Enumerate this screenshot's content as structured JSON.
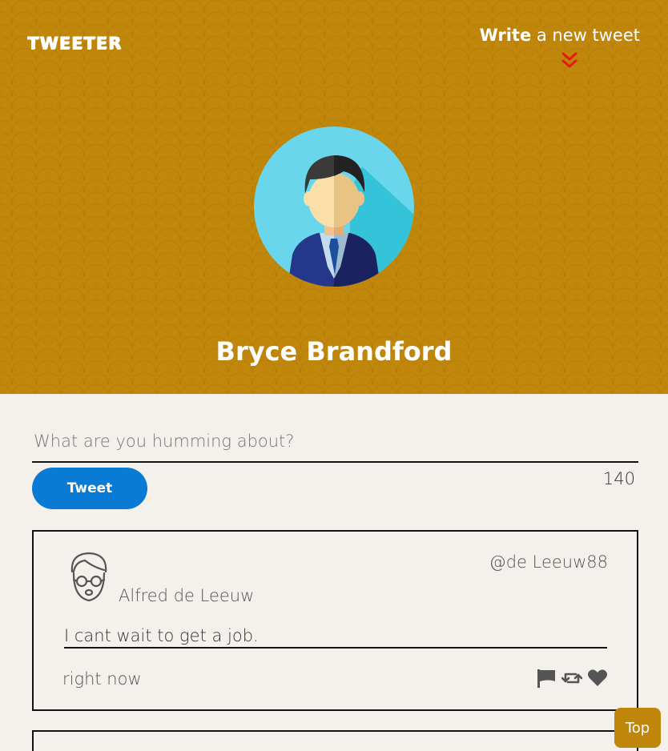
{
  "header": {
    "logo_text": "TWEETER",
    "write_bold": "Write",
    "write_rest": " a new tweet",
    "chevron_icon": "double-chevron-down-icon",
    "chevron_color": "#e8190c",
    "background_color": "#c0860a"
  },
  "profile": {
    "name": "Bryce Brandford",
    "avatar_icon": "businessman-avatar-icon"
  },
  "composer": {
    "placeholder": "What are you humming about?",
    "value": "",
    "tweet_button_label": "Tweet",
    "tweet_button_color": "#0a7bd4",
    "char_count": "140"
  },
  "tweets": [
    {
      "author_name": "Alfred de Leeuw",
      "handle": "@de Leeuw88",
      "text": "I cant wait to get a job.",
      "time": "right now",
      "avatar_icon": "man-with-glasses-avatar-icon",
      "actions": [
        "flag-icon",
        "retweet-icon",
        "heart-icon"
      ]
    }
  ],
  "top_button_label": "Top"
}
